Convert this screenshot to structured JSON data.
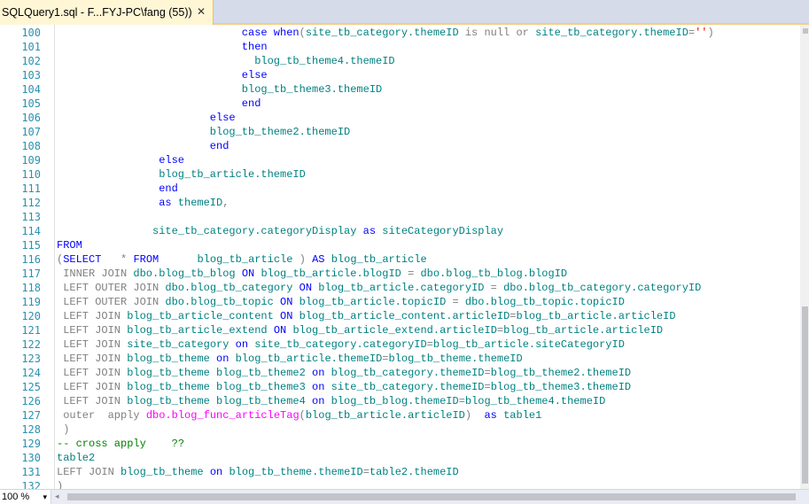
{
  "tab": {
    "title": "SQLQuery1.sql - F...FYJ-PC\\fang (55))",
    "close_glyph": "✕"
  },
  "zoom": {
    "label": "100 %",
    "arrow": "▾"
  },
  "lines": [
    {
      "n": "100",
      "indent": 29,
      "segs": [
        [
          "case when",
          "kw"
        ],
        [
          "(",
          "gr"
        ],
        [
          "site_tb_category.themeID",
          "id"
        ],
        [
          " is null or ",
          "gr"
        ],
        [
          "site_tb_category.themeID",
          "id"
        ],
        [
          "=",
          "gr"
        ],
        [
          "''",
          "st"
        ],
        [
          ")",
          "gr"
        ]
      ]
    },
    {
      "n": "101",
      "indent": 29,
      "segs": [
        [
          "then",
          "kw"
        ]
      ]
    },
    {
      "n": "102",
      "indent": 31,
      "segs": [
        [
          "blog_tb_theme4.themeID",
          "id"
        ]
      ]
    },
    {
      "n": "103",
      "indent": 29,
      "segs": [
        [
          "else",
          "kw"
        ]
      ]
    },
    {
      "n": "104",
      "indent": 29,
      "segs": [
        [
          "blog_tb_theme3.themeID",
          "id"
        ]
      ]
    },
    {
      "n": "105",
      "indent": 29,
      "segs": [
        [
          "end",
          "kw"
        ]
      ]
    },
    {
      "n": "106",
      "indent": 24,
      "segs": [
        [
          "else",
          "kw"
        ]
      ]
    },
    {
      "n": "107",
      "indent": 24,
      "segs": [
        [
          "blog_tb_theme2.themeID",
          "id"
        ]
      ]
    },
    {
      "n": "108",
      "indent": 24,
      "segs": [
        [
          "end",
          "kw"
        ]
      ]
    },
    {
      "n": "109",
      "indent": 16,
      "segs": [
        [
          "else",
          "kw"
        ]
      ]
    },
    {
      "n": "110",
      "indent": 16,
      "segs": [
        [
          "blog_tb_article.themeID",
          "id"
        ]
      ]
    },
    {
      "n": "111",
      "indent": 16,
      "segs": [
        [
          "end",
          "kw"
        ]
      ]
    },
    {
      "n": "112",
      "indent": 16,
      "segs": [
        [
          "as ",
          "kw"
        ],
        [
          "themeID",
          "id"
        ],
        [
          ",",
          "gr"
        ]
      ]
    },
    {
      "n": "113",
      "indent": 0,
      "segs": []
    },
    {
      "n": "114",
      "indent": 15,
      "segs": [
        [
          "site_tb_category.categoryDisplay",
          "id"
        ],
        [
          " as ",
          "kw"
        ],
        [
          "siteCategoryDisplay",
          "id"
        ]
      ]
    },
    {
      "n": "115",
      "indent": 0,
      "segs": [
        [
          "FROM",
          "kw"
        ]
      ]
    },
    {
      "n": "116",
      "indent": 0,
      "segs": [
        [
          "(",
          "gr"
        ],
        [
          "SELECT",
          "kw"
        ],
        [
          "   * ",
          "gr"
        ],
        [
          "FROM",
          "kw"
        ],
        [
          "      ",
          "gr"
        ],
        [
          "blog_tb_article",
          "id"
        ],
        [
          " ) ",
          "gr"
        ],
        [
          "AS ",
          "kw"
        ],
        [
          "blog_tb_article",
          "id"
        ]
      ]
    },
    {
      "n": "117",
      "indent": 1,
      "segs": [
        [
          "INNER JOIN ",
          "gr"
        ],
        [
          "dbo.blog_tb_blog",
          "id"
        ],
        [
          " ON ",
          "kw"
        ],
        [
          "blog_tb_article.blogID",
          "id"
        ],
        [
          " = ",
          "gr"
        ],
        [
          "dbo.blog_tb_blog.blogID",
          "id"
        ]
      ]
    },
    {
      "n": "118",
      "indent": 1,
      "segs": [
        [
          "LEFT OUTER JOIN ",
          "gr"
        ],
        [
          "dbo.blog_tb_category",
          "id"
        ],
        [
          " ON ",
          "kw"
        ],
        [
          "blog_tb_article.categoryID",
          "id"
        ],
        [
          " = ",
          "gr"
        ],
        [
          "dbo.blog_tb_category.categoryID",
          "id"
        ]
      ]
    },
    {
      "n": "119",
      "indent": 1,
      "segs": [
        [
          "LEFT OUTER JOIN ",
          "gr"
        ],
        [
          "dbo.blog_tb_topic",
          "id"
        ],
        [
          " ON ",
          "kw"
        ],
        [
          "blog_tb_article.topicID",
          "id"
        ],
        [
          " = ",
          "gr"
        ],
        [
          "dbo.blog_tb_topic.topicID",
          "id"
        ]
      ]
    },
    {
      "n": "120",
      "indent": 1,
      "segs": [
        [
          "LEFT JOIN ",
          "gr"
        ],
        [
          "blog_tb_article_content",
          "id"
        ],
        [
          " ON ",
          "kw"
        ],
        [
          "blog_tb_article_content.articleID",
          "id"
        ],
        [
          "=",
          "gr"
        ],
        [
          "blog_tb_article.articleID",
          "id"
        ]
      ]
    },
    {
      "n": "121",
      "indent": 1,
      "segs": [
        [
          "LEFT JOIN ",
          "gr"
        ],
        [
          "blog_tb_article_extend",
          "id"
        ],
        [
          " ON ",
          "kw"
        ],
        [
          "blog_tb_article_extend.articleID",
          "id"
        ],
        [
          "=",
          "gr"
        ],
        [
          "blog_tb_article.articleID",
          "id"
        ]
      ]
    },
    {
      "n": "122",
      "indent": 1,
      "segs": [
        [
          "LEFT JOIN ",
          "gr"
        ],
        [
          "site_tb_category",
          "id"
        ],
        [
          " on ",
          "kw"
        ],
        [
          "site_tb_category.categoryID",
          "id"
        ],
        [
          "=",
          "gr"
        ],
        [
          "blog_tb_article.siteCategoryID",
          "id"
        ]
      ]
    },
    {
      "n": "123",
      "indent": 1,
      "segs": [
        [
          "LEFT JOIN ",
          "gr"
        ],
        [
          "blog_tb_theme",
          "id"
        ],
        [
          " on ",
          "kw"
        ],
        [
          "blog_tb_article.themeID",
          "id"
        ],
        [
          "=",
          "gr"
        ],
        [
          "blog_tb_theme.themeID",
          "id"
        ]
      ]
    },
    {
      "n": "124",
      "indent": 1,
      "segs": [
        [
          "LEFT JOIN ",
          "gr"
        ],
        [
          "blog_tb_theme blog_tb_theme2",
          "id"
        ],
        [
          " on ",
          "kw"
        ],
        [
          "blog_tb_category.themeID",
          "id"
        ],
        [
          "=",
          "gr"
        ],
        [
          "blog_tb_theme2.themeID",
          "id"
        ]
      ]
    },
    {
      "n": "125",
      "indent": 1,
      "segs": [
        [
          "LEFT JOIN ",
          "gr"
        ],
        [
          "blog_tb_theme blog_tb_theme3",
          "id"
        ],
        [
          " on ",
          "kw"
        ],
        [
          "site_tb_category.themeID",
          "id"
        ],
        [
          "=",
          "gr"
        ],
        [
          "blog_tb_theme3.themeID",
          "id"
        ]
      ]
    },
    {
      "n": "126",
      "indent": 1,
      "segs": [
        [
          "LEFT JOIN ",
          "gr"
        ],
        [
          "blog_tb_theme blog_tb_theme4",
          "id"
        ],
        [
          " on ",
          "kw"
        ],
        [
          "blog_tb_blog.themeID",
          "id"
        ],
        [
          "=",
          "gr"
        ],
        [
          "blog_tb_theme4.themeID",
          "id"
        ]
      ]
    },
    {
      "n": "127",
      "indent": 1,
      "segs": [
        [
          "outer  apply ",
          "gr"
        ],
        [
          "dbo.blog_func_articleTag",
          "fn"
        ],
        [
          "(",
          "gr"
        ],
        [
          "blog_tb_article.articleID",
          "id"
        ],
        [
          ")  ",
          "gr"
        ],
        [
          "as ",
          "kw"
        ],
        [
          "table1",
          "id"
        ]
      ]
    },
    {
      "n": "128",
      "indent": 1,
      "segs": [
        [
          ")",
          "gr"
        ]
      ]
    },
    {
      "n": "129",
      "indent": 0,
      "segs": [
        [
          "-- cross apply    ??",
          "cm"
        ]
      ]
    },
    {
      "n": "130",
      "indent": 0,
      "segs": [
        [
          "table2",
          "id"
        ]
      ]
    },
    {
      "n": "131",
      "indent": 0,
      "segs": [
        [
          "LEFT JOIN ",
          "gr"
        ],
        [
          "blog_tb_theme",
          "id"
        ],
        [
          " on ",
          "kw"
        ],
        [
          "blog_tb_theme.themeID",
          "id"
        ],
        [
          "=",
          "gr"
        ],
        [
          "table2.themeID",
          "id"
        ]
      ]
    },
    {
      "n": "132",
      "indent": 0,
      "segs": [
        [
          ")",
          "gr"
        ]
      ]
    }
  ]
}
